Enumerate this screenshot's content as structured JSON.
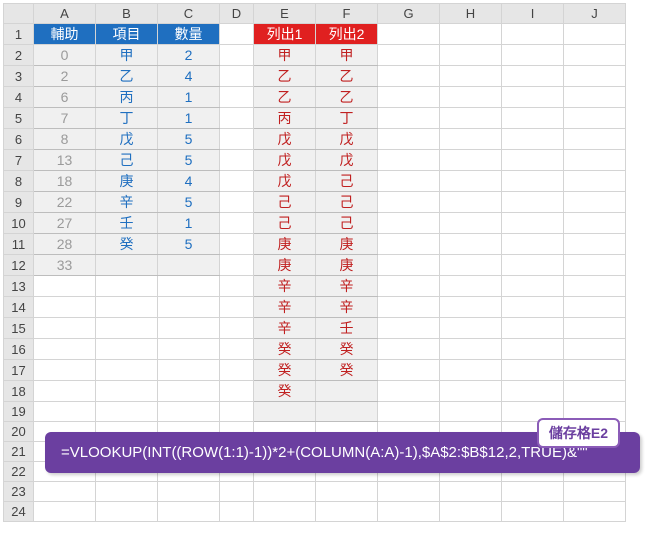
{
  "columns": [
    "A",
    "B",
    "C",
    "D",
    "E",
    "F",
    "G",
    "H",
    "I",
    "J"
  ],
  "rowCount": 24,
  "headers": {
    "A": "輔助",
    "B": "項目",
    "C": "數量",
    "E": "列出1",
    "F": "列出2"
  },
  "tableABC": [
    {
      "a": "0",
      "b": "甲",
      "c": "2"
    },
    {
      "a": "2",
      "b": "乙",
      "c": "4"
    },
    {
      "a": "6",
      "b": "丙",
      "c": "1"
    },
    {
      "a": "7",
      "b": "丁",
      "c": "1"
    },
    {
      "a": "8",
      "b": "戊",
      "c": "5"
    },
    {
      "a": "13",
      "b": "己",
      "c": "5"
    },
    {
      "a": "18",
      "b": "庚",
      "c": "4"
    },
    {
      "a": "22",
      "b": "辛",
      "c": "5"
    },
    {
      "a": "27",
      "b": "壬",
      "c": "1"
    },
    {
      "a": "28",
      "b": "癸",
      "c": "5"
    },
    {
      "a": "33",
      "b": "",
      "c": ""
    }
  ],
  "tableEF": [
    {
      "e": "甲",
      "f": "甲"
    },
    {
      "e": "乙",
      "f": "乙"
    },
    {
      "e": "乙",
      "f": "乙"
    },
    {
      "e": "丙",
      "f": "丁"
    },
    {
      "e": "戊",
      "f": "戊"
    },
    {
      "e": "戊",
      "f": "戊"
    },
    {
      "e": "戊",
      "f": "己"
    },
    {
      "e": "己",
      "f": "己"
    },
    {
      "e": "己",
      "f": "己"
    },
    {
      "e": "庚",
      "f": "庚"
    },
    {
      "e": "庚",
      "f": "庚"
    },
    {
      "e": "辛",
      "f": "辛"
    },
    {
      "e": "辛",
      "f": "辛"
    },
    {
      "e": "辛",
      "f": "壬"
    },
    {
      "e": "癸",
      "f": "癸"
    },
    {
      "e": "癸",
      "f": "癸"
    },
    {
      "e": "癸",
      "f": ""
    },
    {
      "e": "",
      "f": ""
    }
  ],
  "formula": {
    "cellRef": "儲存格E2",
    "text": "=VLOOKUP(INT((ROW(1:1)-1))*2+(COLUMN(A:A)-1),$A$2:$B$12,2,TRUE)&\"\""
  }
}
